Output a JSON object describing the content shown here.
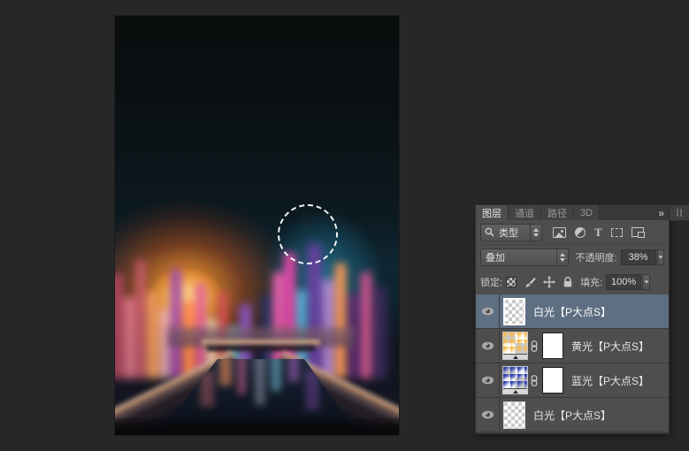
{
  "app": {
    "name": "Photoshop 图层面板"
  },
  "panel": {
    "tabs": [
      {
        "label": "图层",
        "active": true
      },
      {
        "label": "通道",
        "active": false
      },
      {
        "label": "路径",
        "active": false
      },
      {
        "label": "3D",
        "active": false
      }
    ],
    "collapse_icon": "»",
    "filter": {
      "kind_label": "类型"
    },
    "blend": {
      "mode": "叠加",
      "opacity_label": "不透明度:",
      "opacity_value": "38%"
    },
    "lock": {
      "label": "锁定:",
      "fill_label": "填充:",
      "fill_value": "100%"
    },
    "layers": [
      {
        "name": "白光【P大点S】",
        "selected": true,
        "thumb": "transparent",
        "mask": false,
        "visible": true
      },
      {
        "name": "黄光【P大点S】",
        "selected": false,
        "thumb": "gradient-yellow",
        "mask": true,
        "visible": true
      },
      {
        "name": "蓝光【P大点S】",
        "selected": false,
        "thumb": "gradient-blue",
        "mask": true,
        "visible": true
      },
      {
        "name": "白光【P大点S】",
        "selected": false,
        "thumb": "transparent",
        "mask": false,
        "visible": true
      }
    ]
  },
  "canvas": {
    "content": "blurred neon night street with canal and reflections",
    "selection": "elliptical marching-ants selection",
    "colors": {
      "left_glow": "#f08a28",
      "right_glow": "#2d9cc0",
      "sky": "#0c1a21",
      "workspace_bg": "#272727",
      "panel_bg": "#4e4e4e",
      "selected_row": "#5d6f80"
    }
  }
}
